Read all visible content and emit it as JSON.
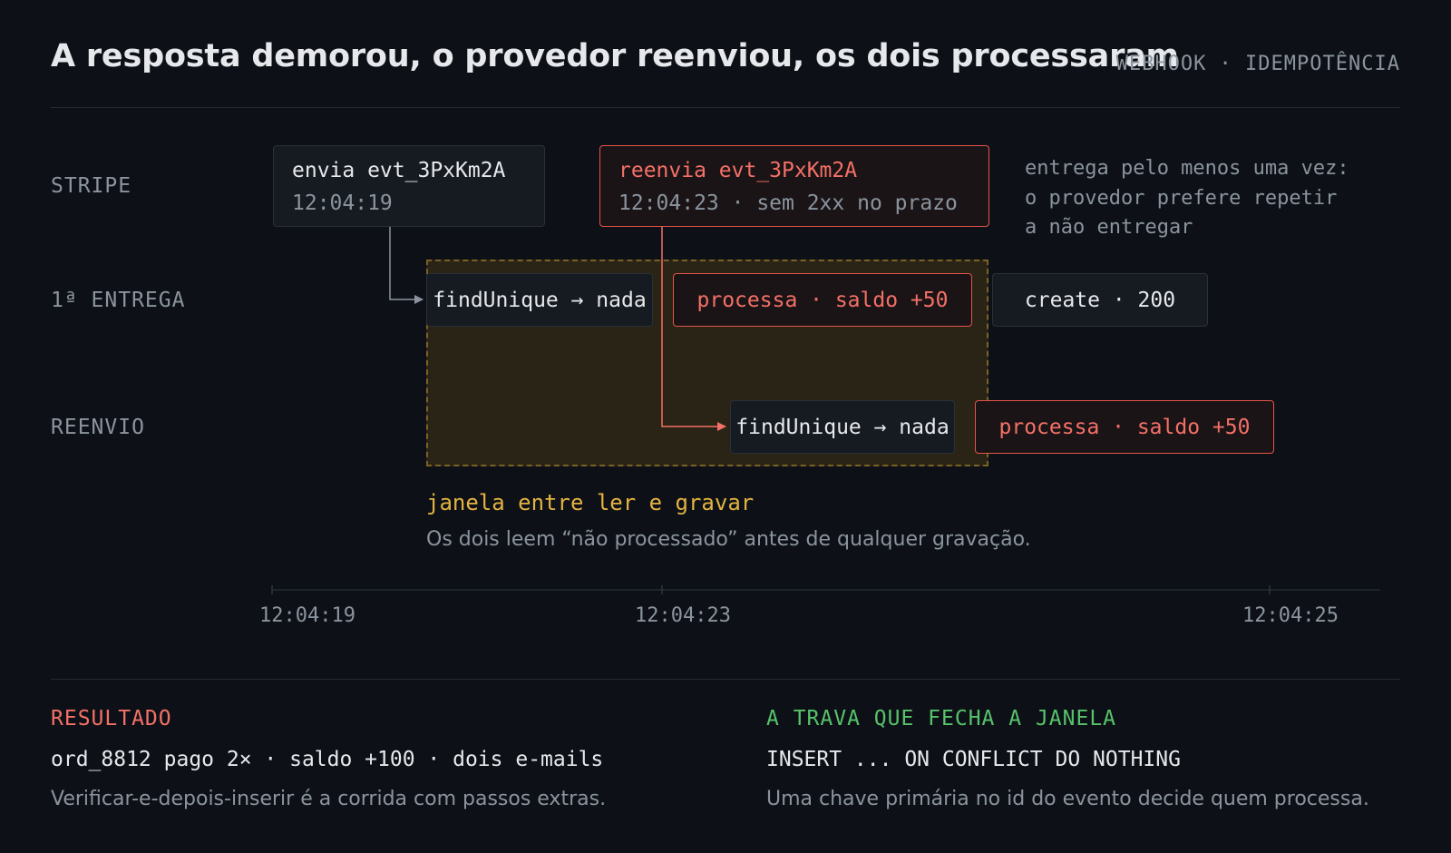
{
  "header": {
    "title": "A resposta demorou, o provedor reenviou, os dois processaram",
    "tag": "WEBHOOK · IDEMPOTÊNCIA"
  },
  "lanes": {
    "stripe": "STRIPE",
    "first": "1ª ENTREGA",
    "retry": "REENVIO"
  },
  "stripe": {
    "send": {
      "label": "envia evt_3PxKm2A",
      "time": "12:04:19"
    },
    "resend": {
      "label": "reenvia evt_3PxKm2A",
      "time": "12:04:23 · sem 2xx no prazo"
    },
    "note": [
      "entrega pelo menos uma vez:",
      "o provedor prefere repetir",
      "a não entregar"
    ]
  },
  "first_delivery": {
    "find": "findUnique → nada",
    "process": "processa · saldo +50",
    "create": "create · 200"
  },
  "retry": {
    "find": "findUnique → nada",
    "process": "processa · saldo +50"
  },
  "window": {
    "label": "janela entre ler e gravar",
    "desc": "Os dois leem “não processado” antes de qualquer gravação."
  },
  "axis": {
    "ticks": [
      "12:04:19",
      "12:04:23",
      "12:04:25"
    ]
  },
  "result": {
    "heading": "RESULTADO",
    "line": "ord_8812 pago 2× · saldo +100 · dois e-mails",
    "desc": "Verificar-e-depois-inserir é a corrida com passos extras."
  },
  "lock": {
    "heading": "A TRAVA QUE FECHA A JANELA",
    "line": "INSERT ... ON CONFLICT DO NOTHING",
    "desc": "Uma chave primária no id do evento decide quem processa."
  },
  "colors": {
    "background": "#0d1117",
    "red": "#f47067",
    "yellow": "#e3b341",
    "green": "#57c26a",
    "muted": "#8b949e"
  }
}
